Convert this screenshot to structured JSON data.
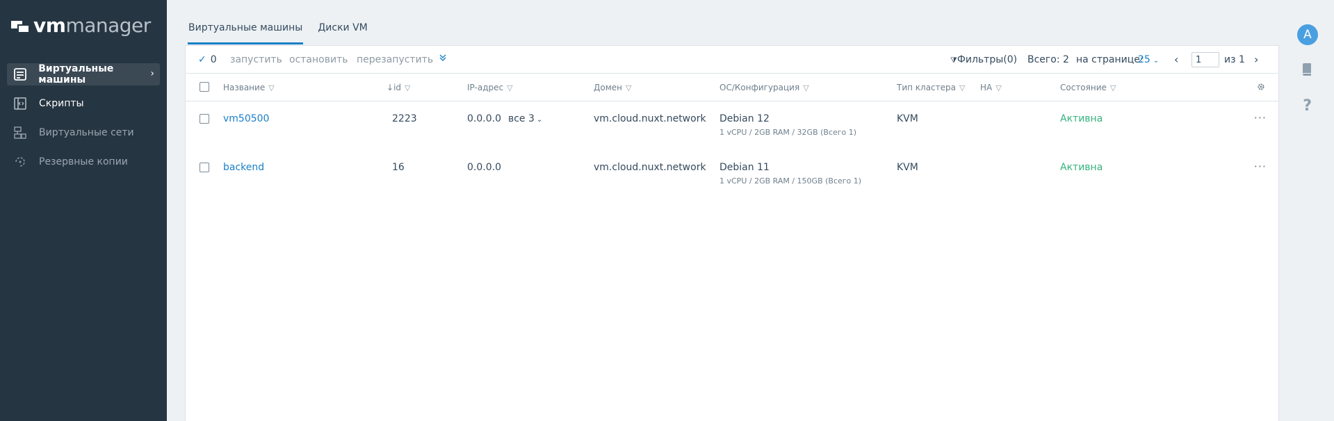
{
  "app": {
    "logo_vm": "vm",
    "logo_manager": "manager"
  },
  "sidebar": {
    "items": [
      {
        "label": "Виртуальные машины",
        "icon": "server-icon"
      },
      {
        "label": "Скрипты",
        "icon": "script-icon"
      },
      {
        "label": "Виртуальные сети",
        "icon": "network-icon"
      },
      {
        "label": "Резервные копии",
        "icon": "backup-icon"
      }
    ]
  },
  "rail": {
    "avatar": "A",
    "help": "?"
  },
  "tabs": [
    {
      "label": "Виртуальные машины",
      "active": true
    },
    {
      "label": "Диски VM",
      "active": false
    }
  ],
  "toolbar": {
    "selected_count": "0",
    "start": "запустить",
    "stop": "остановить",
    "restart": "перезапустить",
    "filters": "Фильтры(0)",
    "total": "Всего: 2",
    "per_page_label": "на странице:",
    "per_page_value": "25",
    "page_value": "1",
    "of_label": "из",
    "pages": "1"
  },
  "columns": {
    "name": "Название",
    "id": "id",
    "ip": "IP-адрес",
    "domain": "Домен",
    "os": "ОС/Конфигурация",
    "cluster": "Тип кластера",
    "ha": "HA",
    "state": "Состояние"
  },
  "rows": [
    {
      "name": "vm50500",
      "id": "2223",
      "ip": "0.0.0.0",
      "ip_more": "все 3",
      "domain": "vm.cloud.nuxt.network",
      "os": "Debian 12",
      "config": "1 vCPU / 2GB RAM / 32GB (Всего 1)",
      "cluster": "KVM",
      "state": "Активна"
    },
    {
      "name": "backend",
      "id": "16",
      "ip": "0.0.0.0",
      "ip_more": "",
      "domain": "vm.cloud.nuxt.network",
      "os": "Debian 11",
      "config": "1 vCPU / 2GB RAM / 150GB (Всего 1)",
      "cluster": "KVM",
      "state": "Активна"
    }
  ],
  "colors": {
    "sidebar_bg": "#263542",
    "accent": "#1a7fc8",
    "status_active": "#36b37e",
    "avatar": "#4a9fe0"
  }
}
